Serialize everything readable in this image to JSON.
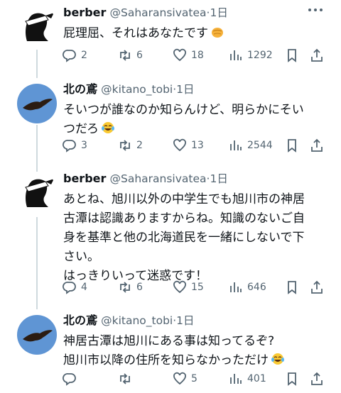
{
  "tweets": [
    {
      "name": "berber",
      "handle": "@Saharansivatea",
      "time": "1日",
      "text": "屁理屈、それはあなたです",
      "emoji": "punch",
      "actions": {
        "reply": "2",
        "retweet": "6",
        "like": "18",
        "views": "1292"
      }
    },
    {
      "name": "北の鳶",
      "handle": "@kitano_tobi",
      "time": "1日",
      "text": "そいつが誰なのか知らんけど、明らかにそい\nつだろ",
      "emoji": "laugh",
      "actions": {
        "reply": "3",
        "retweet": "2",
        "like": "13",
        "views": "2544"
      }
    },
    {
      "name": "berber",
      "handle": "@Saharansivatea",
      "time": "1日",
      "text": "あとね、旭川以外の中学生でも旭川市の神居\n古潭は認識ありますからね。知識のないご自\n身を基準と他の北海道民を一緒にしないで下\nさい。\nはっきりいって迷惑です！",
      "emoji": "",
      "actions": {
        "reply": "4",
        "retweet": "6",
        "like": "15",
        "views": "646"
      }
    },
    {
      "name": "北の鳶",
      "handle": "@kitano_tobi",
      "time": "1日",
      "text": "神居古潭は旭川にある事は知ってるぞ?\n旭川市以降の住所を知らなかっただけ",
      "emoji": "laugh",
      "actions": {
        "reply": "",
        "retweet": "",
        "like": "5",
        "views": "401"
      }
    }
  ],
  "separator": "·"
}
